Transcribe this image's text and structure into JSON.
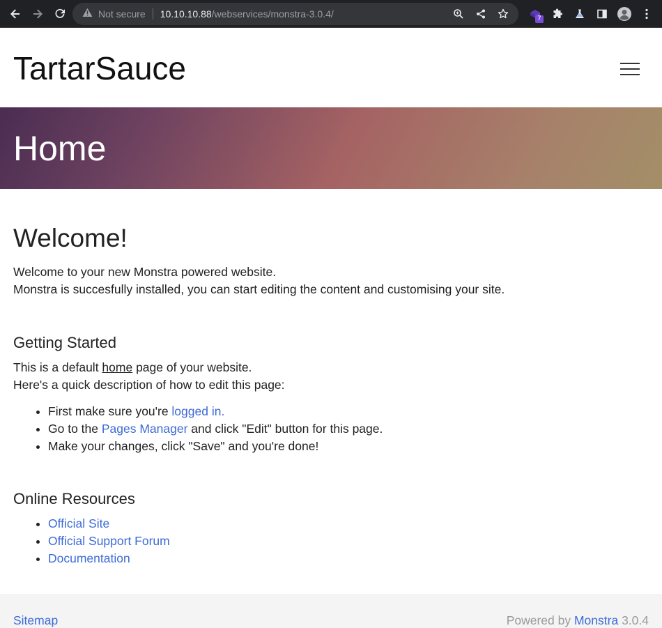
{
  "browser": {
    "security_label": "Not secure",
    "url_host": "10.10.10.88",
    "url_path": "/webservices/monstra-3.0.4/",
    "extension_badge": "7",
    "icons": [
      "back-icon",
      "forward-icon",
      "reload-icon",
      "warning-icon",
      "zoom-icon",
      "share-icon",
      "star-icon",
      "extension-icon",
      "puzzle-icon",
      "lab-icon",
      "sidepanel-icon",
      "profile-icon",
      "kebab-menu-icon"
    ]
  },
  "site": {
    "brand": "TartarSauce",
    "hero_title": "Home"
  },
  "content": {
    "welcome_heading": "Welcome!",
    "welcome_line1": "Welcome to your new Monstra powered website.",
    "welcome_line2": "Monstra is succesfully installed, you can start editing the content and customising your site.",
    "getting_started_heading": "Getting Started",
    "default_prefix": "This is a default ",
    "default_home": "home",
    "default_suffix": " page of your website.",
    "quick_desc": "Here's a quick description of how to edit this page:",
    "steps": {
      "s1_prefix": "First make sure you're ",
      "s1_link": "logged in.",
      "s2_prefix": "Go to the ",
      "s2_link": "Pages Manager",
      "s2_suffix": " and click \"Edit\" button for this page.",
      "s3": "Make your changes, click \"Save\" and you're done!"
    },
    "resources_heading": "Online Resources",
    "resources": [
      "Official Site",
      "Official Support Forum",
      "Documentation"
    ]
  },
  "footer": {
    "sitemap": "Sitemap",
    "powered_prefix": "Powered by ",
    "powered_link": "Monstra",
    "powered_version": " 3.0.4"
  },
  "colors": {
    "link": "#3c6bd6",
    "chrome_bg": "#202124",
    "footer_bg": "#f4f4f5"
  }
}
